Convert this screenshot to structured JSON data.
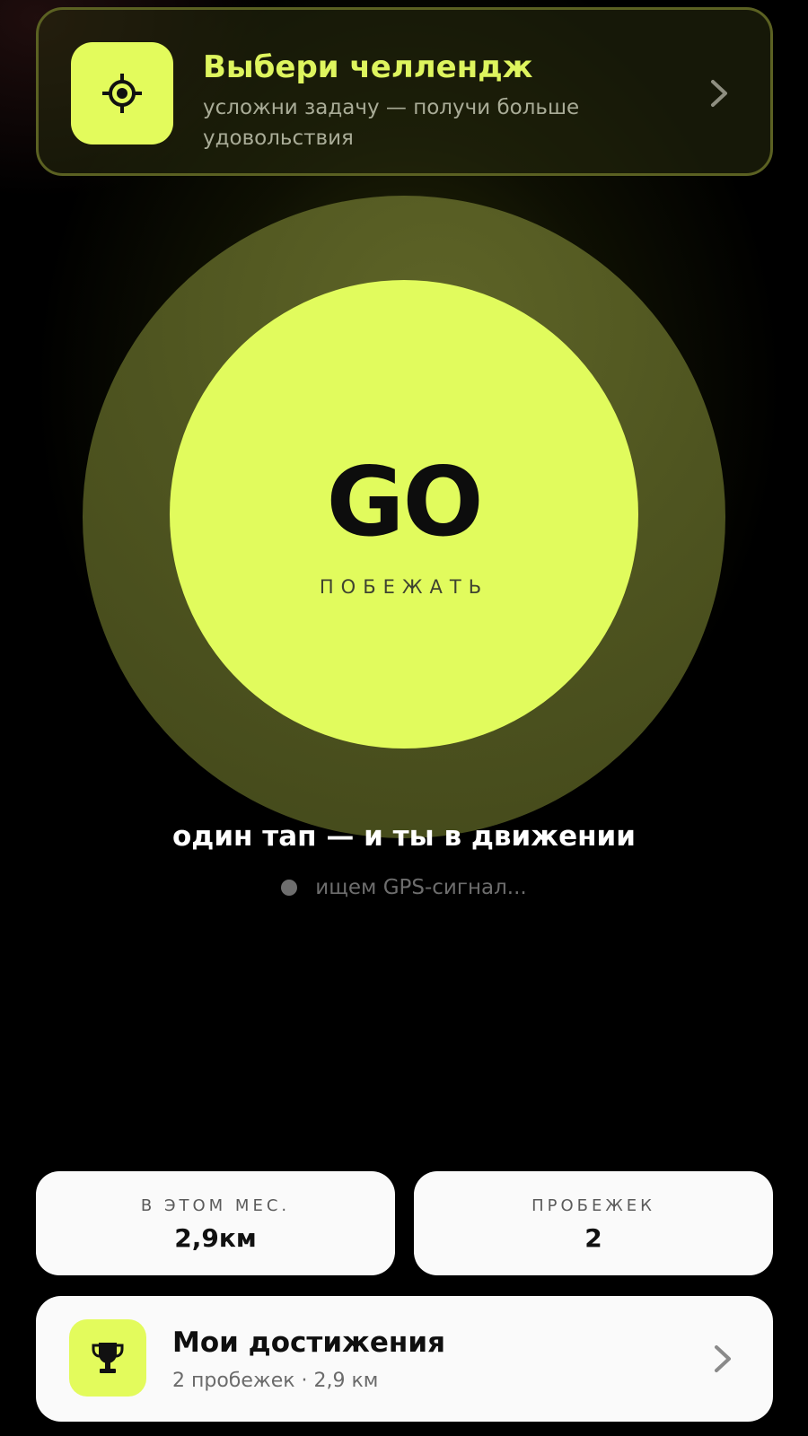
{
  "challenge": {
    "title": "Выбери челлендж",
    "subtitle": "усложни задачу — получи больше удовольствия",
    "icon": "target-icon",
    "chevron": "chevron-right-icon"
  },
  "go_button": {
    "label": "GO",
    "sublabel": "ПОБЕЖАТЬ"
  },
  "tagline": "один тап — и ты в движении",
  "gps_status": "ищем GPS-сигнал...",
  "stats": [
    {
      "label": "В ЭТОМ МЕС.",
      "value": "2,9км"
    },
    {
      "label": "ПРОБЕЖЕК",
      "value": "2"
    }
  ],
  "achievements": {
    "title": "Мои достижения",
    "subtitle": "2 пробежек · 2,9 км",
    "icon": "trophy-icon",
    "chevron": "chevron-right-icon"
  },
  "colors": {
    "accent": "#e1fb5d",
    "ring": "#4f5520",
    "card_bg": "#fafafa"
  }
}
